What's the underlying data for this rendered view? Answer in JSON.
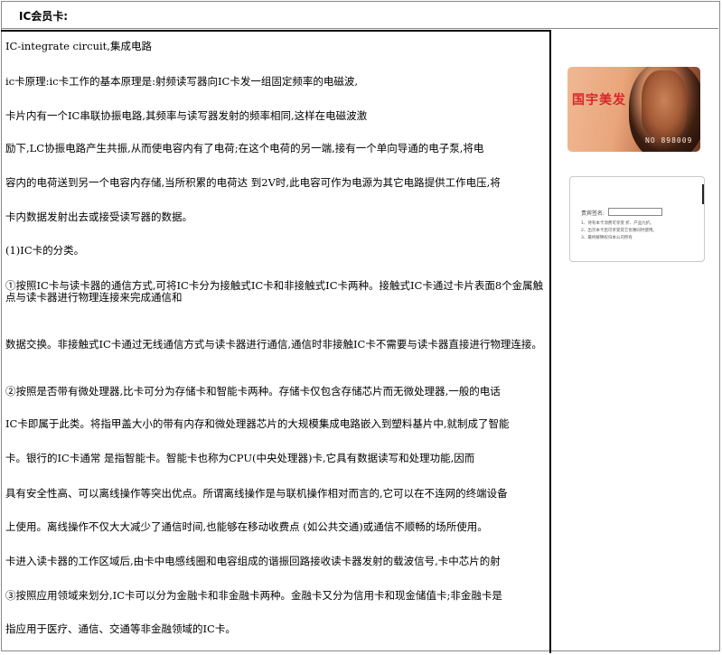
{
  "header": {
    "title": "IC会员卡:"
  },
  "lines": [
    "IC-integrate circuit,集成电路",
    "ic卡原理:ic卡工作的基本原理是:射频读写器向IC卡发一组固定频率的电磁波,",
    "卡片内有一个IC串联协振电路,其频率与读写器发射的频率相同,这样在电磁波激",
    "励下,LC协振电路产生共振,从而使电容内有了电荷;在这个电荷的另一端,接有一个单向导通的电子泵,将电",
    "容内的电荷送到另一个电容内存储,当所积累的电荷达 到2V时,此电容可作为电源为其它电路提供工作电压,将",
    "卡内数据发射出去或接受读写器的数据。",
    "(1)IC卡的分类。",
    "①按照IC卡与读卡器的通信方式,可将IC卡分为接触式IC卡和非接触式IC卡两种。接触式IC卡通过卡片表面8个金属触点与读卡器进行物理连接来完成通信和",
    "数据交换。非接触式IC卡通过无线通信方式与读卡器进行通信,通信时非接触IC卡不需要与读卡器直接进行物理连接。",
    "②按照是否带有微处理器,比卡可分为存储卡和智能卡两种。存储卡仅包含存储芯片而无微处理器,一般的电话",
    "IC卡即属于此类。将指甲盖大小的带有内存和微处理器芯片的大规模集成电路嵌入到塑料基片中,就制成了智能",
    "卡。银行的IC卡通常 是指智能卡。智能卡也称为CPU(中央处理器)卡,它具有数据读写和处理功能,因而",
    "具有安全性高、可以离线操作等突出优点。所谓离线操作是与联机操作相对而言的,它可以在不连网的终端设备",
    "上使用。离线操作不仅大大减少了通信时间,也能够在移动收费点 (如公共交通)或通信不顺畅的场所使用。",
    "卡进入读卡器的工作区域后,由卡中电感线圈和电容组成的谐振回路接收读卡器发射的载波信号,卡中芯片的射",
    "③按照应用领域来划分,IC卡可以分为金融卡和非金融卡两种。金融卡又分为信用卡和现金储值卡;非金融卡是",
    "指应用于医疗、通信、交通等非金融领域的IC卡。"
  ],
  "card_front": {
    "title": "国宇美发",
    "number": "NO 898009"
  },
  "card_back": {
    "signature_label": "贵宾签名:",
    "notes": [
      "1、持有本卡消费可享受 折、产品九折。",
      "2、出示本卡后可享受其它优惠同时使用。",
      "3、最终解释权归本公司所有"
    ]
  }
}
